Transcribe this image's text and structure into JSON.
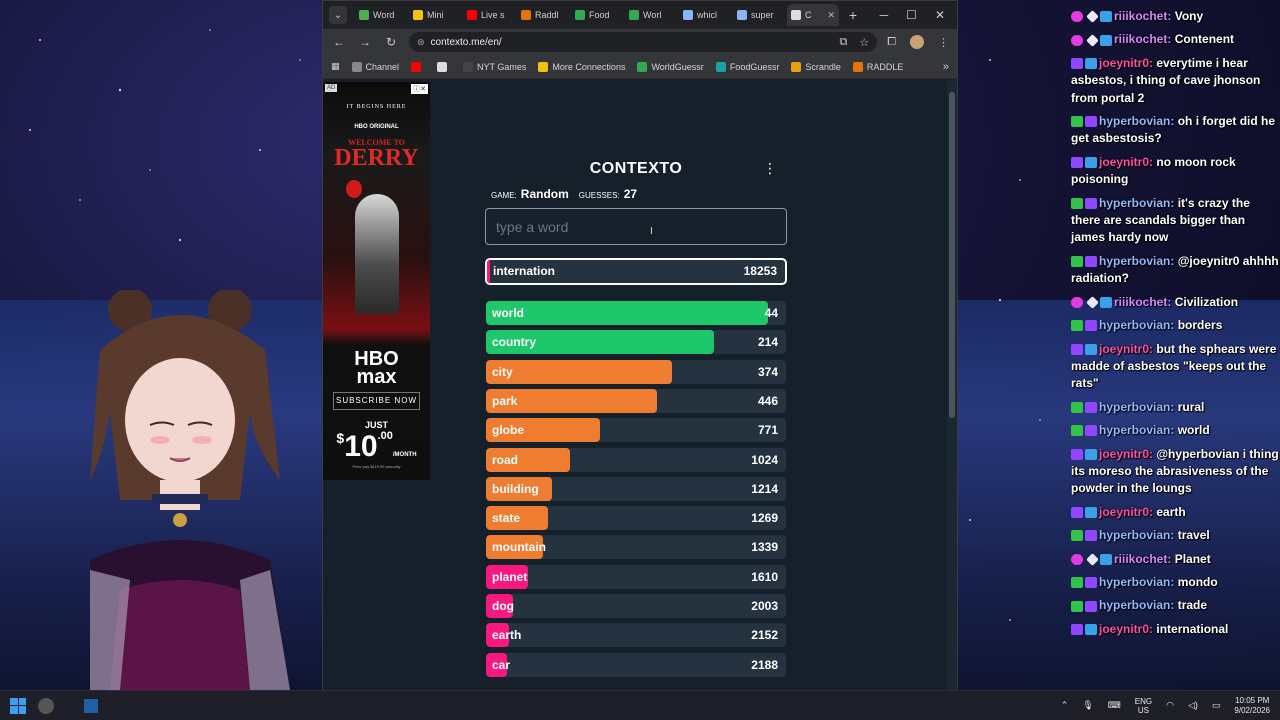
{
  "browser": {
    "tabs": [
      {
        "label": "Word",
        "color": "#4caf50"
      },
      {
        "label": "Mini",
        "color": "#f4c20d"
      },
      {
        "label": "Live s",
        "color": "#ff0000"
      },
      {
        "label": "Raddl",
        "color": "#e8710a"
      },
      {
        "label": "Food",
        "color": "#34a853"
      },
      {
        "label": "Worl",
        "color": "#34a853"
      },
      {
        "label": "whicl",
        "color": "#8ab4f8"
      },
      {
        "label": "super",
        "color": "#8ab4f8"
      },
      {
        "label": "C",
        "color": "#dddddd",
        "active": true
      }
    ],
    "new_tab": "+",
    "window_controls": {
      "minimize": "─",
      "maximize": "☐",
      "close": "✕"
    },
    "url": "contexto.me/en/",
    "bookmarks": [
      {
        "label": "Channel",
        "color": "#888888"
      },
      {
        "label": "",
        "color": "#ff0000"
      },
      {
        "label": "",
        "color": "#dddddd"
      },
      {
        "label": "NYT Games",
        "color": "#444444"
      },
      {
        "label": "More Connections",
        "color": "#f4c20d"
      },
      {
        "label": "WorldGuessr",
        "color": "#34a853"
      },
      {
        "label": "FoodGuessr",
        "color": "#1aa3a3"
      },
      {
        "label": "Scrandle",
        "color": "#e8a00d"
      },
      {
        "label": "RADDLE",
        "color": "#e8710a"
      }
    ]
  },
  "ad": {
    "tag": "AD",
    "tagline": "IT BEGINS HERE",
    "hbo_original": "HBO ORIGINAL",
    "title_small": "WELCOME TO",
    "title_big": "DERRY",
    "brand_1": "HBO",
    "brand_2": "max",
    "cta": "SUBSCRIBE NOW",
    "just": "JUST",
    "price_dollar": "$",
    "price_whole": "10",
    "price_cents": ".00",
    "price_period": "/MONTH",
    "fine_print": "Price pay $119.99 annually"
  },
  "game": {
    "title": "CONTEXTO",
    "game_label": "game:",
    "game_value": "Random",
    "guesses_label": "guesses:",
    "guesses_value": "27",
    "input_placeholder": "type a word",
    "last_guess": {
      "word": "internation",
      "distance": "18253"
    },
    "guesses": [
      {
        "word": "world",
        "distance": "44",
        "fill": 0.94,
        "color": "#1ec86a"
      },
      {
        "word": "country",
        "distance": "214",
        "fill": 0.76,
        "color": "#1ec86a"
      },
      {
        "word": "city",
        "distance": "374",
        "fill": 0.62,
        "color": "#ef7d31"
      },
      {
        "word": "park",
        "distance": "446",
        "fill": 0.57,
        "color": "#ef7d31"
      },
      {
        "word": "globe",
        "distance": "771",
        "fill": 0.38,
        "color": "#ef7d31"
      },
      {
        "word": "road",
        "distance": "1024",
        "fill": 0.28,
        "color": "#ef7d31"
      },
      {
        "word": "building",
        "distance": "1214",
        "fill": 0.22,
        "color": "#ef7d31"
      },
      {
        "word": "state",
        "distance": "1269",
        "fill": 0.205,
        "color": "#ef7d31"
      },
      {
        "word": "mountain",
        "distance": "1339",
        "fill": 0.19,
        "color": "#ef7d31"
      },
      {
        "word": "planet",
        "distance": "1610",
        "fill": 0.14,
        "color": "#f91880"
      },
      {
        "word": "dog",
        "distance": "2003",
        "fill": 0.09,
        "color": "#f91880"
      },
      {
        "word": "earth",
        "distance": "2152",
        "fill": 0.075,
        "color": "#f91880"
      },
      {
        "word": "car",
        "distance": "2188",
        "fill": 0.07,
        "color": "#f91880"
      }
    ]
  },
  "chat": [
    {
      "badges": [
        "heart",
        "star",
        "prime"
      ],
      "nick": "riiikochet:",
      "nick_class": "n-r",
      "text": "Vony"
    },
    {
      "badges": [
        "heart",
        "star",
        "prime"
      ],
      "nick": "riiikochet:",
      "nick_class": "n-r",
      "text": "Contenent"
    },
    {
      "badges": [
        "sub",
        "prime"
      ],
      "nick": "joeynitr0:",
      "nick_class": "n-j",
      "text": "everytime i hear asbestos, i thing of cave jhonson from portal 2"
    },
    {
      "badges": [
        "mod",
        "sub"
      ],
      "nick": "hyperbovian:",
      "nick_class": "n-h",
      "text": "oh i forget did he get asbestosis?"
    },
    {
      "badges": [
        "sub",
        "prime"
      ],
      "nick": "joeynitr0:",
      "nick_class": "n-j",
      "text": "no moon rock poisoning"
    },
    {
      "badges": [
        "mod",
        "sub"
      ],
      "nick": "hyperbovian:",
      "nick_class": "n-h",
      "text": "it's crazy the there are scandals bigger than james hardy now"
    },
    {
      "badges": [
        "mod",
        "sub"
      ],
      "nick": "hyperbovian:",
      "nick_class": "n-h",
      "text": "@joeynitr0 ahhhh radiation?"
    },
    {
      "badges": [
        "heart",
        "star",
        "prime"
      ],
      "nick": "riiikochet:",
      "nick_class": "n-r",
      "text": "Civilization"
    },
    {
      "badges": [
        "mod",
        "sub"
      ],
      "nick": "hyperbovian:",
      "nick_class": "n-h",
      "text": "borders"
    },
    {
      "badges": [
        "sub",
        "prime"
      ],
      "nick": "joeynitr0:",
      "nick_class": "n-j",
      "text": "but the sphears were madde of asbestos \"keeps out the rats\""
    },
    {
      "badges": [
        "mod",
        "sub"
      ],
      "nick": "hyperbovian:",
      "nick_class": "n-h",
      "text": "rural"
    },
    {
      "badges": [
        "mod",
        "sub"
      ],
      "nick": "hyperbovian:",
      "nick_class": "n-h",
      "text": "world"
    },
    {
      "badges": [
        "sub",
        "prime"
      ],
      "nick": "joeynitr0:",
      "nick_class": "n-j",
      "text": "@hyperbovian i thing its moreso the abrasiveness of the powder in the loungs"
    },
    {
      "badges": [
        "sub",
        "prime"
      ],
      "nick": "joeynitr0:",
      "nick_class": "n-j",
      "text": "earth"
    },
    {
      "badges": [
        "mod",
        "sub"
      ],
      "nick": "hyperbovian:",
      "nick_class": "n-h",
      "text": "travel"
    },
    {
      "badges": [
        "heart",
        "star",
        "prime"
      ],
      "nick": "riiikochet:",
      "nick_class": "n-r",
      "text": "Planet"
    },
    {
      "badges": [
        "mod",
        "sub"
      ],
      "nick": "hyperbovian:",
      "nick_class": "n-h",
      "text": "mondo"
    },
    {
      "badges": [
        "mod",
        "sub"
      ],
      "nick": "hyperbovian:",
      "nick_class": "n-h",
      "text": "trade"
    },
    {
      "badges": [
        "sub",
        "prime"
      ],
      "nick": "joeynitr0:",
      "nick_class": "n-j",
      "text": "international"
    }
  ],
  "taskbar": {
    "lang_1": "ENG",
    "lang_2": "US",
    "time": "10:05 PM",
    "date": "9/02/2026"
  }
}
